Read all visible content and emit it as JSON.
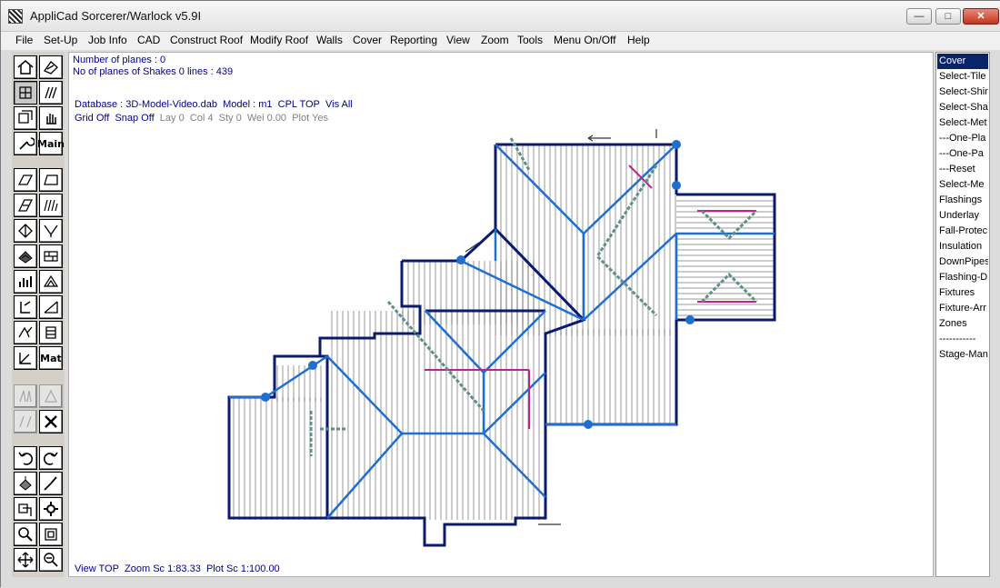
{
  "window": {
    "title": "AppliCad Sorcerer/Warlock v5.9I"
  },
  "menu": [
    "File",
    "Set-Up",
    "Job Info",
    "CAD",
    "Construct Roof",
    "Modify Roof",
    "Walls",
    "Cover",
    "Reporting",
    "View",
    "Zoom",
    "Tools",
    "Menu On/Off",
    "Help"
  ],
  "info": {
    "planes": "Number of planes : 0",
    "shakes": "No of planes of Shakes 0 lines : 439",
    "database": "Database : 3D-Model-Video.dab",
    "model": "Model : m1",
    "cpl": "CPL TOP",
    "vis": "Vis All",
    "grid": "Grid Off",
    "snap": "Snap Off",
    "lay": "Lay 0",
    "col": "Col 4",
    "sty": "Sty 0",
    "wei": "Wei 0.00",
    "plot": "Plot Yes"
  },
  "status": {
    "view": "View TOP",
    "zoom": "Zoom Sc 1:83.33",
    "plot": "Plot Sc 1:100.00"
  },
  "toolbar_icons": [
    "roof-icon",
    "shake-icon",
    "grid-icon",
    "fan-icon",
    "layers-icon",
    "hand-icon",
    "wrench-icon",
    "main-icon",
    "plane-icon",
    "plane2-icon",
    "cut-icon",
    "hatch-icon",
    "hip-icon",
    "valley-icon",
    "tile-icon",
    "brick-icon",
    "chart-icon",
    "gable-icon",
    "trim-icon",
    "slope-icon",
    "dormer-icon",
    "stack-icon",
    "pitch-icon",
    "mat-icon",
    "mirror-icon",
    "mirror2-icon",
    "mirror3-icon",
    "delete-icon",
    "undo-icon",
    "redo-icon",
    "paint-icon",
    "brush-icon",
    "copy-icon",
    "gear-icon",
    "zoom-in-icon",
    "zoom-fit-icon",
    "pan-icon",
    "zoom-window-icon"
  ],
  "toolbar_main_label": "Main",
  "toolbar_mat_label": "Mat",
  "right_panel": [
    "Cover",
    "Select-Tile",
    "Select-Shin",
    "Select-Sha",
    "Select-Met",
    "---One-Pla",
    "---One-Pa",
    "---Reset",
    "Select-Me",
    "Flashings",
    "Underlay",
    "Fall-Protec",
    "Insulation",
    "DownPipes",
    "Flashing-D",
    "Fixtures",
    "Fixture-Arr",
    "Zones",
    "-----------",
    "Stage-Man"
  ],
  "colors": {
    "selected": "#0a246a",
    "info_text": "#00008b",
    "ridge": "#1f6fd1",
    "outline": "#0b1a6e",
    "gutter": "#5e8f8a",
    "flashing": "#c02090"
  }
}
